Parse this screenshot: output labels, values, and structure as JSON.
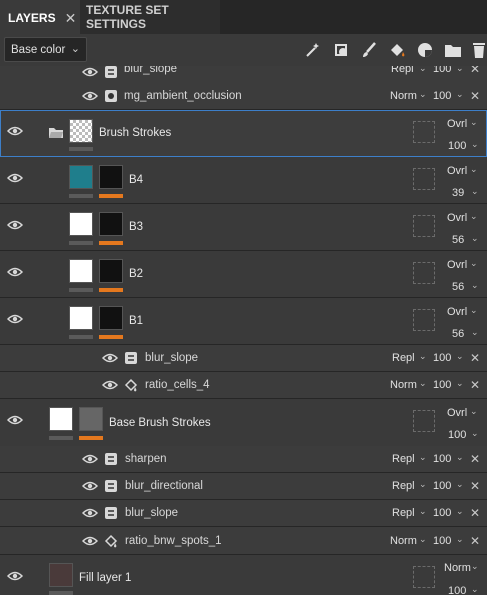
{
  "tabs": {
    "layers": "LAYERS",
    "texture_set_settings": "TEXTURE SET SETTINGS",
    "close_glyph": "✕"
  },
  "toolbar": {
    "channel_dropdown": "Base color",
    "tools": [
      "add-effect-icon",
      "add-mask-icon",
      "add-paint-layer-icon",
      "add-fill-layer-icon",
      "add-smart-material-icon",
      "add-folder-icon",
      "delete-layer-icon"
    ]
  },
  "colors": {
    "accent_blue": "#3d7fc9",
    "orange_bar": "#e4781e",
    "teal_thumb": "#1f7e8c"
  },
  "rows": {
    "r0": {
      "name": "blur_slope",
      "blend": "Repl",
      "opacity": "100"
    },
    "r1": {
      "name": "mg_ambient_occlusion",
      "blend": "Norm",
      "opacity": "100"
    },
    "r2": {
      "name": "Brush Strokes",
      "blend": "Ovrl",
      "opacity": "100"
    },
    "r3": {
      "name": "B4",
      "blend": "Ovrl",
      "opacity": "39"
    },
    "r4": {
      "name": "B3",
      "blend": "Ovrl",
      "opacity": "56"
    },
    "r5": {
      "name": "B2",
      "blend": "Ovrl",
      "opacity": "56"
    },
    "r6": {
      "name": "B1",
      "blend": "Ovrl",
      "opacity": "56"
    },
    "r7": {
      "name": "blur_slope",
      "blend": "Repl",
      "opacity": "100"
    },
    "r8": {
      "name": "ratio_cells_4",
      "blend": "Norm",
      "opacity": "100"
    },
    "r9": {
      "name": "Base Brush Strokes",
      "blend": "Ovrl",
      "opacity": "100"
    },
    "r10": {
      "name": "sharpen",
      "blend": "Repl",
      "opacity": "100"
    },
    "r11": {
      "name": "blur_directional",
      "blend": "Repl",
      "opacity": "100"
    },
    "r12": {
      "name": "blur_slope",
      "blend": "Repl",
      "opacity": "100"
    },
    "r13": {
      "name": "ratio_bnw_spots_1",
      "blend": "Norm",
      "opacity": "100"
    },
    "r14": {
      "name": "Fill layer 1",
      "blend": "Norm",
      "opacity": "100"
    }
  },
  "glyphs": {
    "chev": "⌄",
    "close": "✕"
  }
}
